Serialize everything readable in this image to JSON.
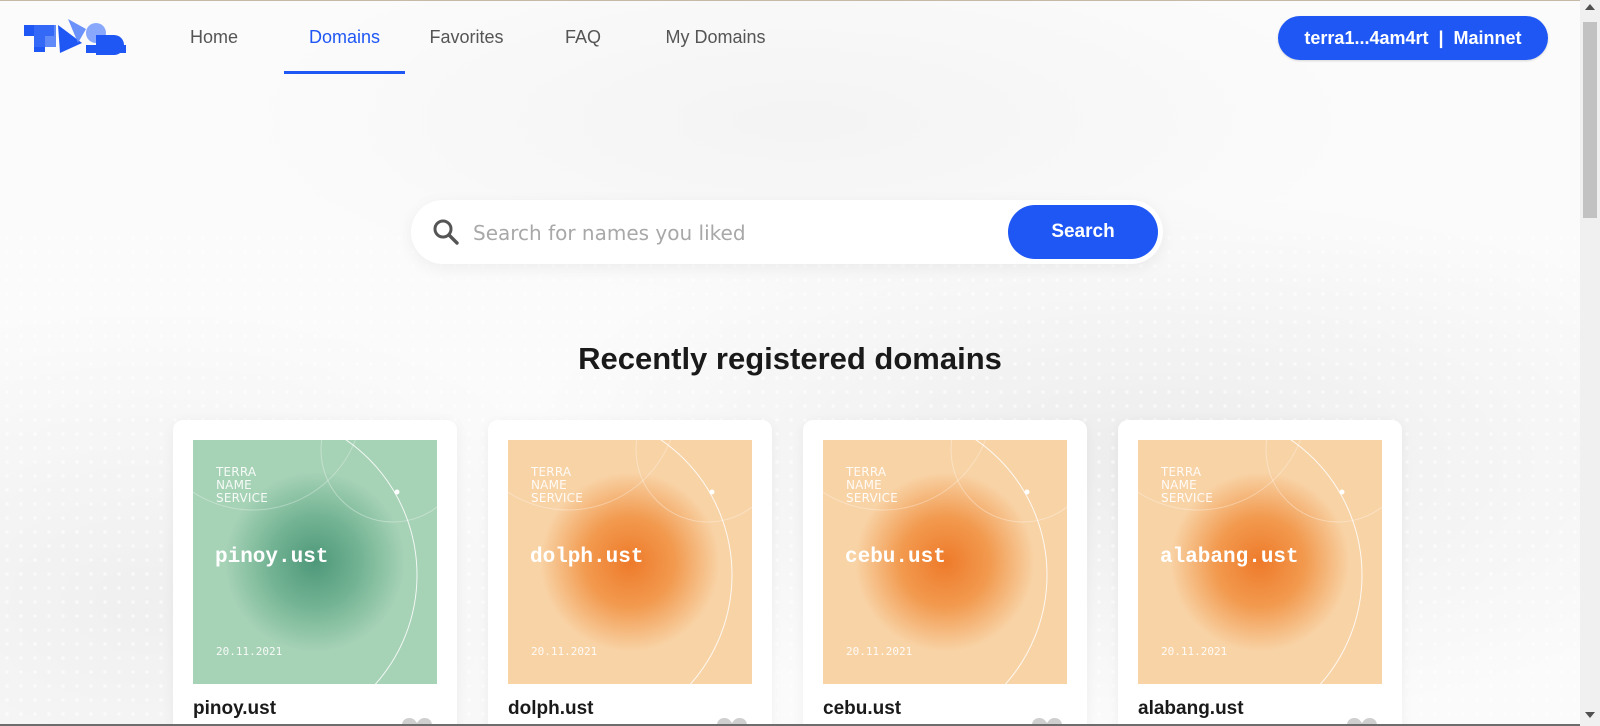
{
  "header": {
    "logo_icon": "tns-logo",
    "nav": [
      {
        "label": "Home"
      },
      {
        "label": "Domains",
        "active": true
      },
      {
        "label": "Favorites"
      },
      {
        "label": "FAQ"
      },
      {
        "label": "My Domains"
      }
    ],
    "wallet": {
      "address": "terra1...4am4rt",
      "separator": "|",
      "network": "Mainnet"
    }
  },
  "search": {
    "icon": "search-icon",
    "placeholder": "Search for names you liked",
    "value": "",
    "button_label": "Search"
  },
  "recent": {
    "title": "Recently registered domains",
    "cards": [
      {
        "art_brand": [
          "TERRA",
          "NAME",
          "SERVICE"
        ],
        "art_name": "pinoy.ust",
        "date": "20.11.2021",
        "title": "pinoy.ust",
        "theme": "green",
        "theme_color": "#a6d2b6",
        "favorite_icon": "heart-icon"
      },
      {
        "art_brand": [
          "TERRA",
          "NAME",
          "SERVICE"
        ],
        "art_name": "dolph.ust",
        "date": "20.11.2021",
        "title": "dolph.ust",
        "theme": "orange",
        "theme_color": "#f8d3a6",
        "favorite_icon": "heart-icon"
      },
      {
        "art_brand": [
          "TERRA",
          "NAME",
          "SERVICE"
        ],
        "art_name": "cebu.ust",
        "date": "20.11.2021",
        "title": "cebu.ust",
        "theme": "orange",
        "theme_color": "#f8d3a6",
        "favorite_icon": "heart-icon"
      },
      {
        "art_brand": [
          "TERRA",
          "NAME",
          "SERVICE"
        ],
        "art_name": "alabang.ust",
        "date": "20.11.2021",
        "title": "alabang.ust",
        "theme": "orange",
        "theme_color": "#f8d3a6",
        "favorite_icon": "heart-icon"
      }
    ]
  },
  "colors": {
    "accent": "#1f57f5",
    "text_dark": "#1a1a1a",
    "nav_text": "#555555"
  }
}
